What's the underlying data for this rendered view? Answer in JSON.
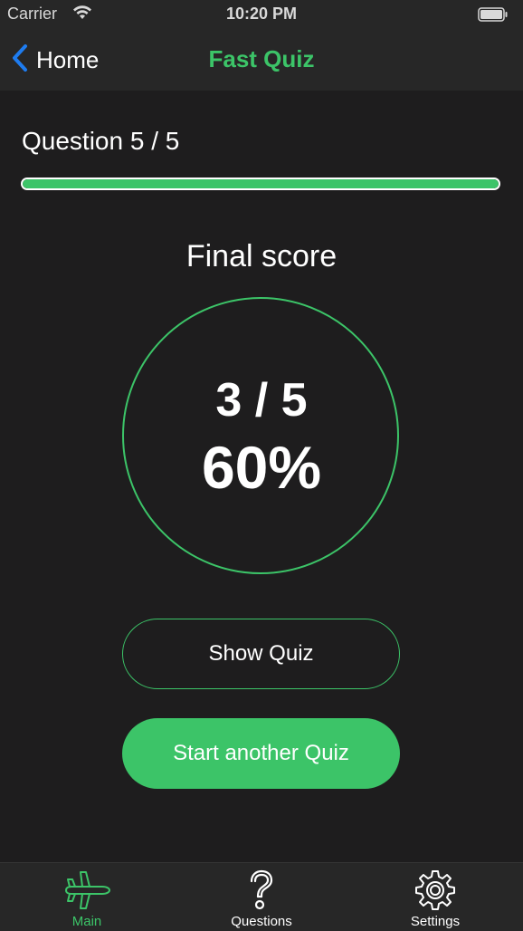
{
  "status_bar": {
    "carrier": "Carrier",
    "time": "10:20 PM"
  },
  "nav": {
    "back_label": "Home",
    "title": "Fast Quiz"
  },
  "quiz": {
    "question_counter": "Question 5 / 5",
    "progress_fraction": 1.0,
    "final_score_label": "Final score",
    "score_fraction": "3 / 5",
    "score_percent": "60%"
  },
  "actions": {
    "show_quiz_label": "Show Quiz",
    "start_another_label": "Start another Quiz"
  },
  "tab_bar": {
    "tabs": [
      {
        "label": "Main",
        "icon": "airplane-icon",
        "active": true
      },
      {
        "label": "Questions",
        "icon": "question-mark-icon",
        "active": false
      },
      {
        "label": "Settings",
        "icon": "gear-icon",
        "active": false
      }
    ]
  },
  "colors": {
    "accent": "#3cc468",
    "background": "#1e1d1e",
    "bar_background": "#272727",
    "back_chevron": "#1e7cf0"
  }
}
